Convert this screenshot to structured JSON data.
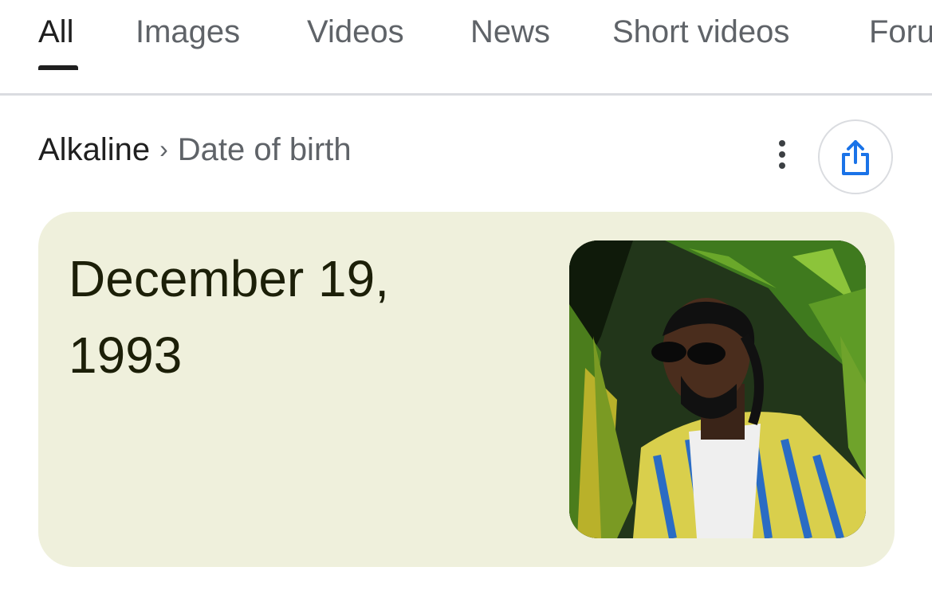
{
  "tabs": [
    "All",
    "Images",
    "Videos",
    "News",
    "Short videos",
    "Foru"
  ],
  "active_tab": "All",
  "breadcrumb": {
    "entity": "Alkaline",
    "separator": "›",
    "attribute": "Date of birth"
  },
  "answer": {
    "line1": "December 19,",
    "line2": "1993"
  },
  "icons": {
    "more": "more-vert-icon",
    "share": "share-icon"
  },
  "colors": {
    "card_background": "#eff0dc",
    "share_accent": "#1a73e8",
    "active_tab_text": "#1f1f1f",
    "inactive_tab_text": "#5f6368"
  }
}
